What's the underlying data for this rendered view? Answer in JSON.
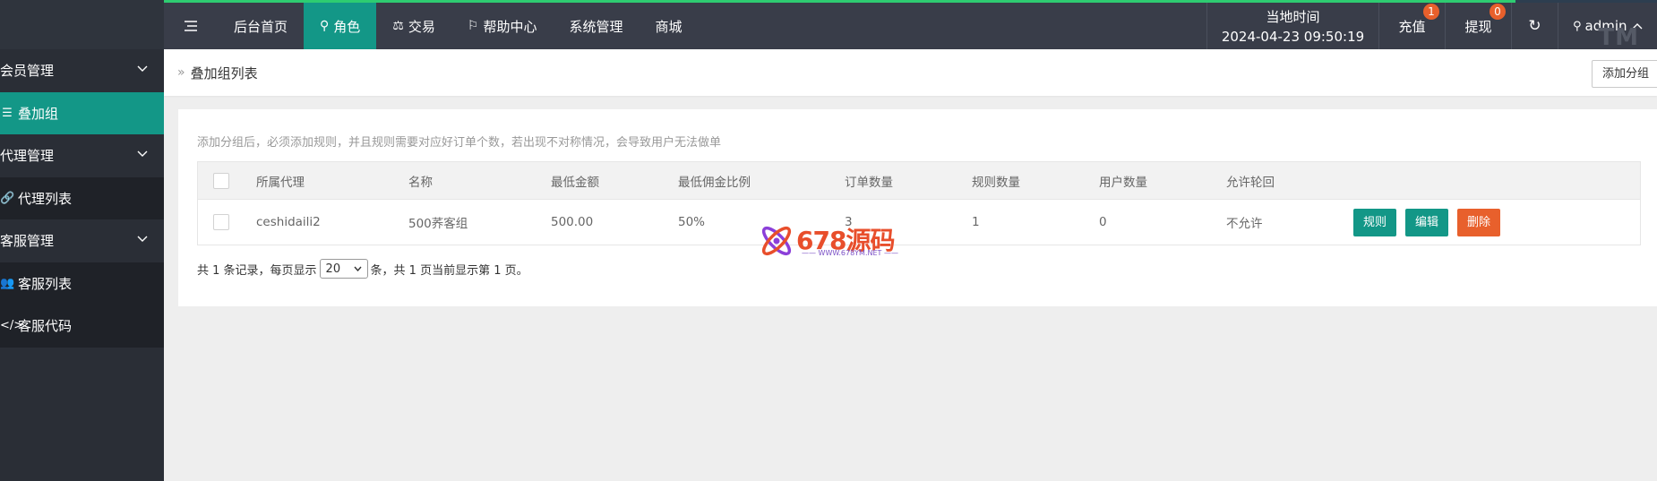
{
  "sidebar": {
    "items": [
      {
        "label": "会员管理",
        "type": "group"
      },
      {
        "label": "叠加组",
        "type": "sub",
        "active": true
      },
      {
        "label": "代理管理",
        "type": "group"
      },
      {
        "label": "代理列表",
        "type": "sub"
      },
      {
        "label": "客服管理",
        "type": "group"
      },
      {
        "label": "客服列表",
        "type": "sub"
      },
      {
        "label": "客服代码",
        "type": "sub"
      }
    ]
  },
  "header": {
    "nav": [
      {
        "label": "后台首页"
      },
      {
        "label": "角色",
        "active": true
      },
      {
        "label": "交易"
      },
      {
        "label": "帮助中心"
      },
      {
        "label": "系统管理"
      },
      {
        "label": "商城"
      }
    ],
    "time_label": "当地时间",
    "time_value": "2024-04-23 09:50:19",
    "recharge_label": "充值",
    "recharge_badge": "1",
    "withdraw_label": "提现",
    "withdraw_badge": "0",
    "user_label": "admin",
    "tm_mark": "TM"
  },
  "breadcrumb": {
    "title": "叠加组列表",
    "add_button": "添加分组"
  },
  "card": {
    "tip": "添加分组后，必须添加规则，并且规则需要对应好订单个数，若出现不对称情况，会导致用户无法做单",
    "columns": [
      "所属代理",
      "名称",
      "最低金额",
      "最低佣金比例",
      "订单数量",
      "规则数量",
      "用户数量",
      "允许轮回"
    ],
    "rows": [
      {
        "agent": "ceshidaili2",
        "name": "500荞客组",
        "min_amount": "500.00",
        "min_rate": "50%",
        "orders": "3",
        "rules": "1",
        "users": "0",
        "cycle": "不允许"
      }
    ],
    "actions": {
      "rule": "规则",
      "edit": "编辑",
      "delete": "删除"
    },
    "pager": {
      "prefix": "共 1 条记录，每页显示",
      "page_size": "20",
      "suffix": "条，共 1 页当前显示第 1 页。"
    }
  },
  "watermark": {
    "brand": "678源码",
    "url": "WWW.678YM.NET"
  },
  "colors": {
    "accent": "#139787",
    "danger": "#e8602c",
    "header": "#393d49",
    "sidebar": "#2a2e36"
  }
}
